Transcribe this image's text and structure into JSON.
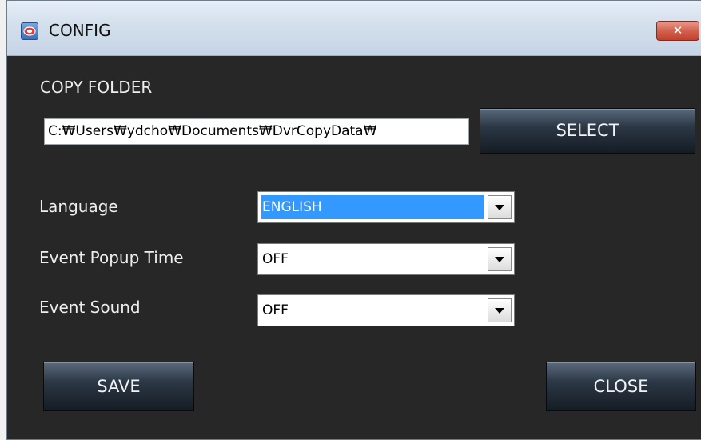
{
  "window": {
    "title": "CONFIG",
    "close_glyph": "✕",
    "app_icon": "app-logo-icon"
  },
  "copy_folder": {
    "label": "COPY FOLDER",
    "path": "C:₩Users₩ydcho₩Documents₩DvrCopyData₩",
    "select_label": "SELECT"
  },
  "settings": [
    {
      "label": "Language",
      "value": "ENGLISH",
      "selected": true
    },
    {
      "label": "Event Popup Time",
      "value": "OFF",
      "selected": false
    },
    {
      "label": "Event Sound",
      "value": "OFF",
      "selected": false
    }
  ],
  "footer": {
    "save_label": "SAVE",
    "close_label": "CLOSE"
  },
  "colors": {
    "background": "#272727",
    "button": "#2c3846",
    "selection": "#3399ff",
    "close_button": "#d4614f"
  }
}
